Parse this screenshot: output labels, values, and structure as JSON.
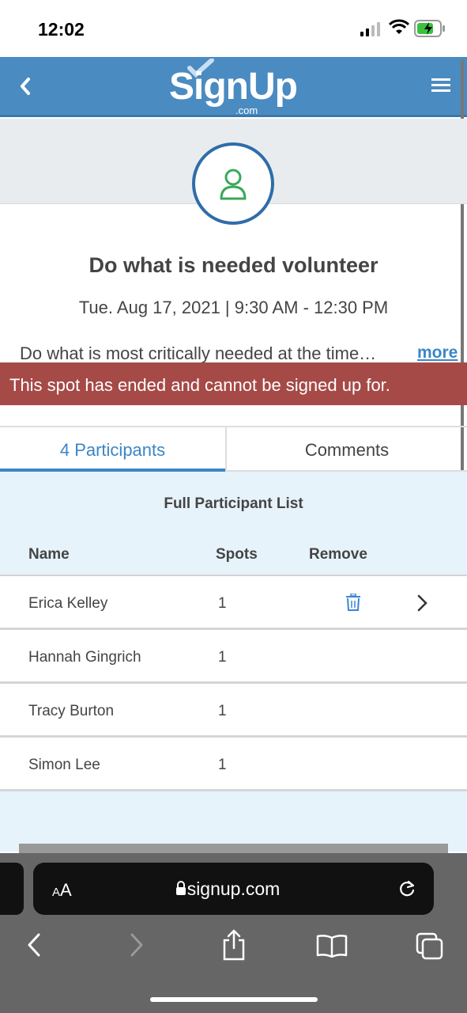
{
  "status": {
    "time": "12:02"
  },
  "header": {
    "logo_text": "SignUp",
    "logo_suffix": ".com"
  },
  "spot": {
    "title": "Do what is needed volunteer",
    "datetime": "Tue. Aug 17, 2021 | 9:30 AM - 12:30 PM",
    "description": "Do what is most critically needed at the time…",
    "more_label": "more",
    "alert": "This spot has ended and cannot be signed up for."
  },
  "tabs": [
    {
      "label": "4 Participants",
      "active": true
    },
    {
      "label": "Comments",
      "active": false
    }
  ],
  "list": {
    "title": "Full Participant List",
    "columns": {
      "name": "Name",
      "spots": "Spots",
      "remove": "Remove"
    },
    "rows": [
      {
        "name": "Erica Kelley",
        "spots": "1"
      },
      {
        "name": "Hannah Gingrich",
        "spots": "1"
      },
      {
        "name": "Tracy Burton",
        "spots": "1"
      },
      {
        "name": "Simon Lee",
        "spots": "1"
      }
    ]
  },
  "browser": {
    "aa_label": "AA",
    "url": "signup.com"
  },
  "colors": {
    "header": "#4a8bc2",
    "alert": "#a64a47",
    "accent": "#3b86c6",
    "panel": "#e7f3fb"
  }
}
